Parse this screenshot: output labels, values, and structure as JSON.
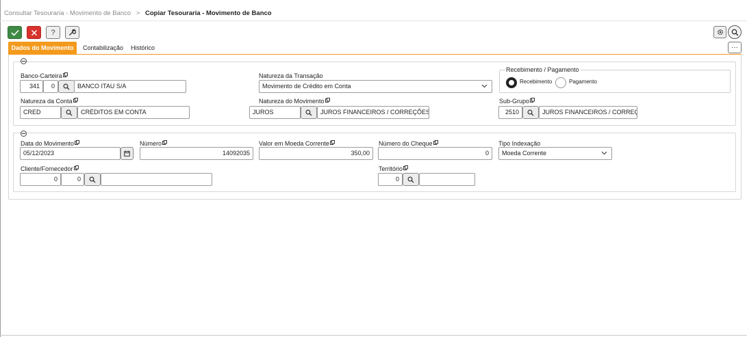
{
  "breadcrumb": {
    "parent": "Consultar Tesouraria - Movimento de Banco",
    "separator": ">",
    "current": "Copiar Tesouraria - Movimento de Banco"
  },
  "toolbar": {
    "ok_icon": "check-icon",
    "cancel_icon": "close-icon",
    "help_label": "?",
    "tool_icon": "wrench-icon",
    "settings_icon": "gear-icon",
    "search_icon": "search-icon",
    "more_label": "···"
  },
  "tabs": [
    {
      "label": "Dados do Movimento",
      "active": true
    },
    {
      "label": "Contabilização",
      "active": false
    },
    {
      "label": "Histórico",
      "active": false
    }
  ],
  "colors": {
    "accent": "#f39a1d",
    "ok": "#3f8a45",
    "cancel": "#d8322c"
  },
  "section1": {
    "banco_carteira": {
      "label": "Banco-Carteira",
      "banco": "341",
      "carteira": "0",
      "descricao": "BANCO ITAU S/A"
    },
    "natureza_transacao": {
      "label": "Natureza da Transação",
      "value": "Movimento de Crédito em Conta"
    },
    "recebimento_pagamento": {
      "label": "Recebimento / Pagamento",
      "options": [
        "Recebimento",
        "Pagamento"
      ],
      "selected": "Recebimento"
    },
    "natureza_conta": {
      "label": "Natureza da Conta",
      "codigo": "CRED",
      "descricao": "CRÉDITOS EM CONTA"
    },
    "natureza_movimento": {
      "label": "Natureza do Movimento",
      "codigo": "JUROS",
      "descricao": "JUROS FINANCEIROS / CORREÇÕES"
    },
    "sub_grupo": {
      "label": "Sub-Grupo",
      "codigo": "2510",
      "descricao": "JUROS FINANCEIROS / CORREÇÕES"
    }
  },
  "section2": {
    "data_movimento": {
      "label": "Data do Movimento",
      "value": "05/12/2023"
    },
    "numero": {
      "label": "Número",
      "value": "14092035"
    },
    "valor": {
      "label": "Valor em Moeda Corrente",
      "value": "350,00"
    },
    "numero_cheque": {
      "label": "Número do Cheque",
      "value": "0"
    },
    "tipo_indexacao": {
      "label": "Tipo Indexação",
      "value": "Moeda Corrente"
    },
    "cliente_fornecedor": {
      "label": "Cliente/Fornecedor",
      "codigo1": "0",
      "codigo2": "0",
      "descricao": ""
    },
    "territorio": {
      "label": "Território",
      "codigo": "0",
      "descricao": ""
    }
  }
}
